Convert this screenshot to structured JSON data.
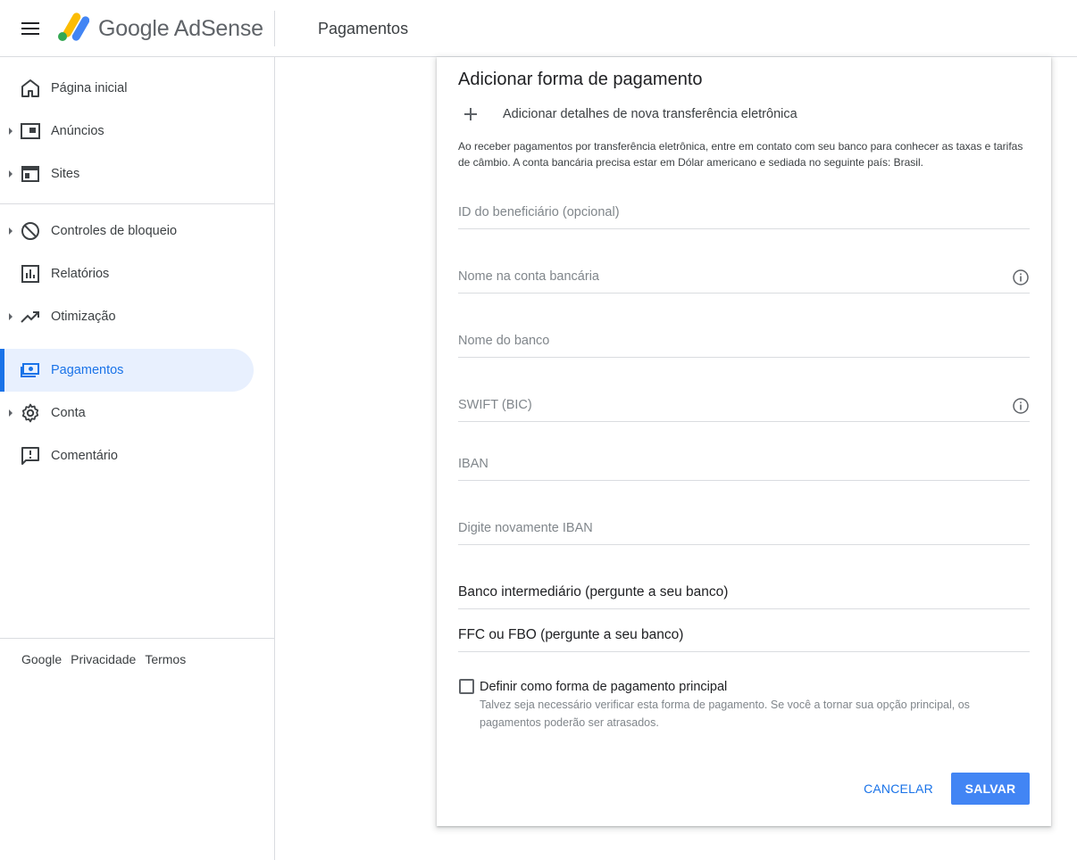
{
  "header": {
    "brand": "Google AdSense",
    "page_title": "Pagamentos",
    "colors": {
      "logo_yellow": "#fbbc04",
      "logo_blue": "#4285f4",
      "logo_green": "#34a853"
    }
  },
  "sidebar": {
    "items": [
      {
        "label": "Página inicial",
        "icon": "home-icon",
        "expandable": false
      },
      {
        "label": "Anúncios",
        "icon": "ads-icon",
        "expandable": true
      },
      {
        "label": "Sites",
        "icon": "sites-icon",
        "expandable": true
      },
      {
        "label": "Controles de bloqueio",
        "icon": "block-icon",
        "expandable": true
      },
      {
        "label": "Relatórios",
        "icon": "reports-icon",
        "expandable": false
      },
      {
        "label": "Otimização",
        "icon": "trending-up-icon",
        "expandable": true
      },
      {
        "label": "Pagamentos",
        "icon": "payments-icon",
        "expandable": false,
        "active": true
      },
      {
        "label": "Conta",
        "icon": "gear-icon",
        "expandable": true
      },
      {
        "label": "Comentário",
        "icon": "feedback-icon",
        "expandable": false
      }
    ],
    "footer": {
      "google": "Google",
      "privacy": "Privacidade",
      "terms": "Termos"
    },
    "active_color": "#1a73e8"
  },
  "form": {
    "title": "Adicionar forma de pagamento",
    "add_label": "Adicionar detalhes de nova transferência eletrônica",
    "info_text": "Ao receber pagamentos por transferência eletrônica, entre em contato com seu banco para conhecer as taxas e tarifas de câmbio. A conta bancária precisa estar em Dólar americano e sediada no seguinte país: Brasil.",
    "fields": {
      "beneficiary_id": "ID do beneficiário (opcional)",
      "account_name": "Nome na conta bancária",
      "bank_name": "Nome do banco",
      "swift": "SWIFT (BIC)",
      "iban": "IBAN",
      "iban_confirm": "Digite novamente IBAN",
      "intermediary_bank": "Banco intermediário (pergunte a seu banco)",
      "ffc_fbo": "FFC ou FBO (pergunte a seu banco)"
    },
    "primary_checkbox": {
      "label": "Definir como forma de pagamento principal",
      "description": "Talvez seja necessário verificar esta forma de pagamento. Se você a tornar sua opção principal, os pagamentos poderão ser atrasados.",
      "checked": false
    },
    "cancel_label": "CANCELAR",
    "save_label": "SALVAR",
    "save_color": "#4285f4"
  }
}
